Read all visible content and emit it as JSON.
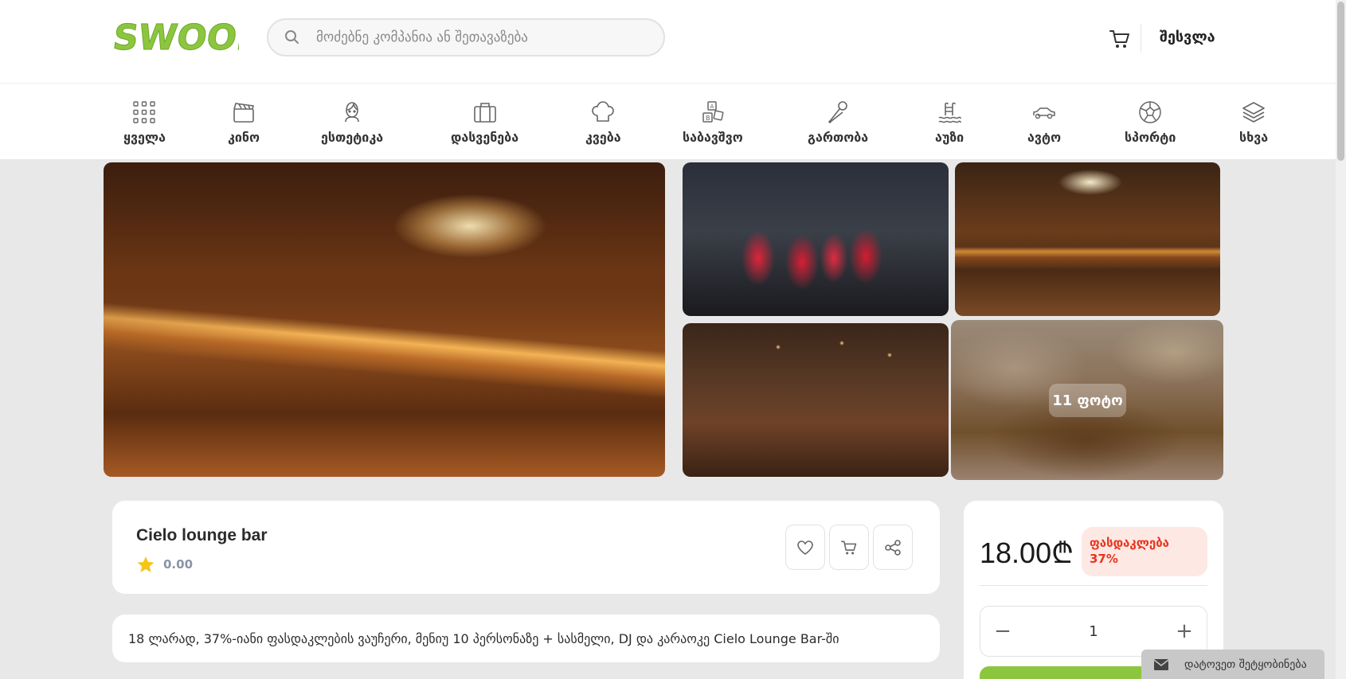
{
  "header": {
    "logo_text": "SWOOP",
    "search_placeholder": "მოძებნე კომპანია ან შეთავაზება",
    "login_label": "შესვლა"
  },
  "categories": [
    {
      "label": "ყველა",
      "icon": "grid-icon"
    },
    {
      "label": "კინო",
      "icon": "clapperboard-icon"
    },
    {
      "label": "ესთეტიკა",
      "icon": "face-icon"
    },
    {
      "label": "დასვენება",
      "icon": "suitcase-icon"
    },
    {
      "label": "კვება",
      "icon": "chef-hat-icon"
    },
    {
      "label": "საბავშვო",
      "icon": "toy-blocks-icon"
    },
    {
      "label": "გართობა",
      "icon": "microphone-icon"
    },
    {
      "label": "აუზი",
      "icon": "pool-icon"
    },
    {
      "label": "ავტო",
      "icon": "car-icon"
    },
    {
      "label": "სპორტი",
      "icon": "football-icon"
    },
    {
      "label": "სხვა",
      "icon": "layers-icon"
    }
  ],
  "gallery": {
    "photo_count_label": "11 ფოტო"
  },
  "offer": {
    "title": "Cielo lounge bar",
    "rating": "0.00",
    "description": "18 ლარად, 37%-იანი ფასდაკლების ვაუჩერი, მენიუ 10 პერსონაზე + სასმელი, DJ და კარაოკე Cielo Lounge Bar-ში"
  },
  "pricing": {
    "price": "18.00₾",
    "discount_label": "ფასდაკლება 37%",
    "quantity": "1",
    "minus": "−",
    "plus": "+"
  },
  "feedback": {
    "label": "დატოვეთ შეტყობინება"
  },
  "colors": {
    "brand_green": "#8cc63f",
    "discount_red": "#e8341c",
    "discount_bg": "#fde8e4",
    "star": "#f5c518"
  }
}
